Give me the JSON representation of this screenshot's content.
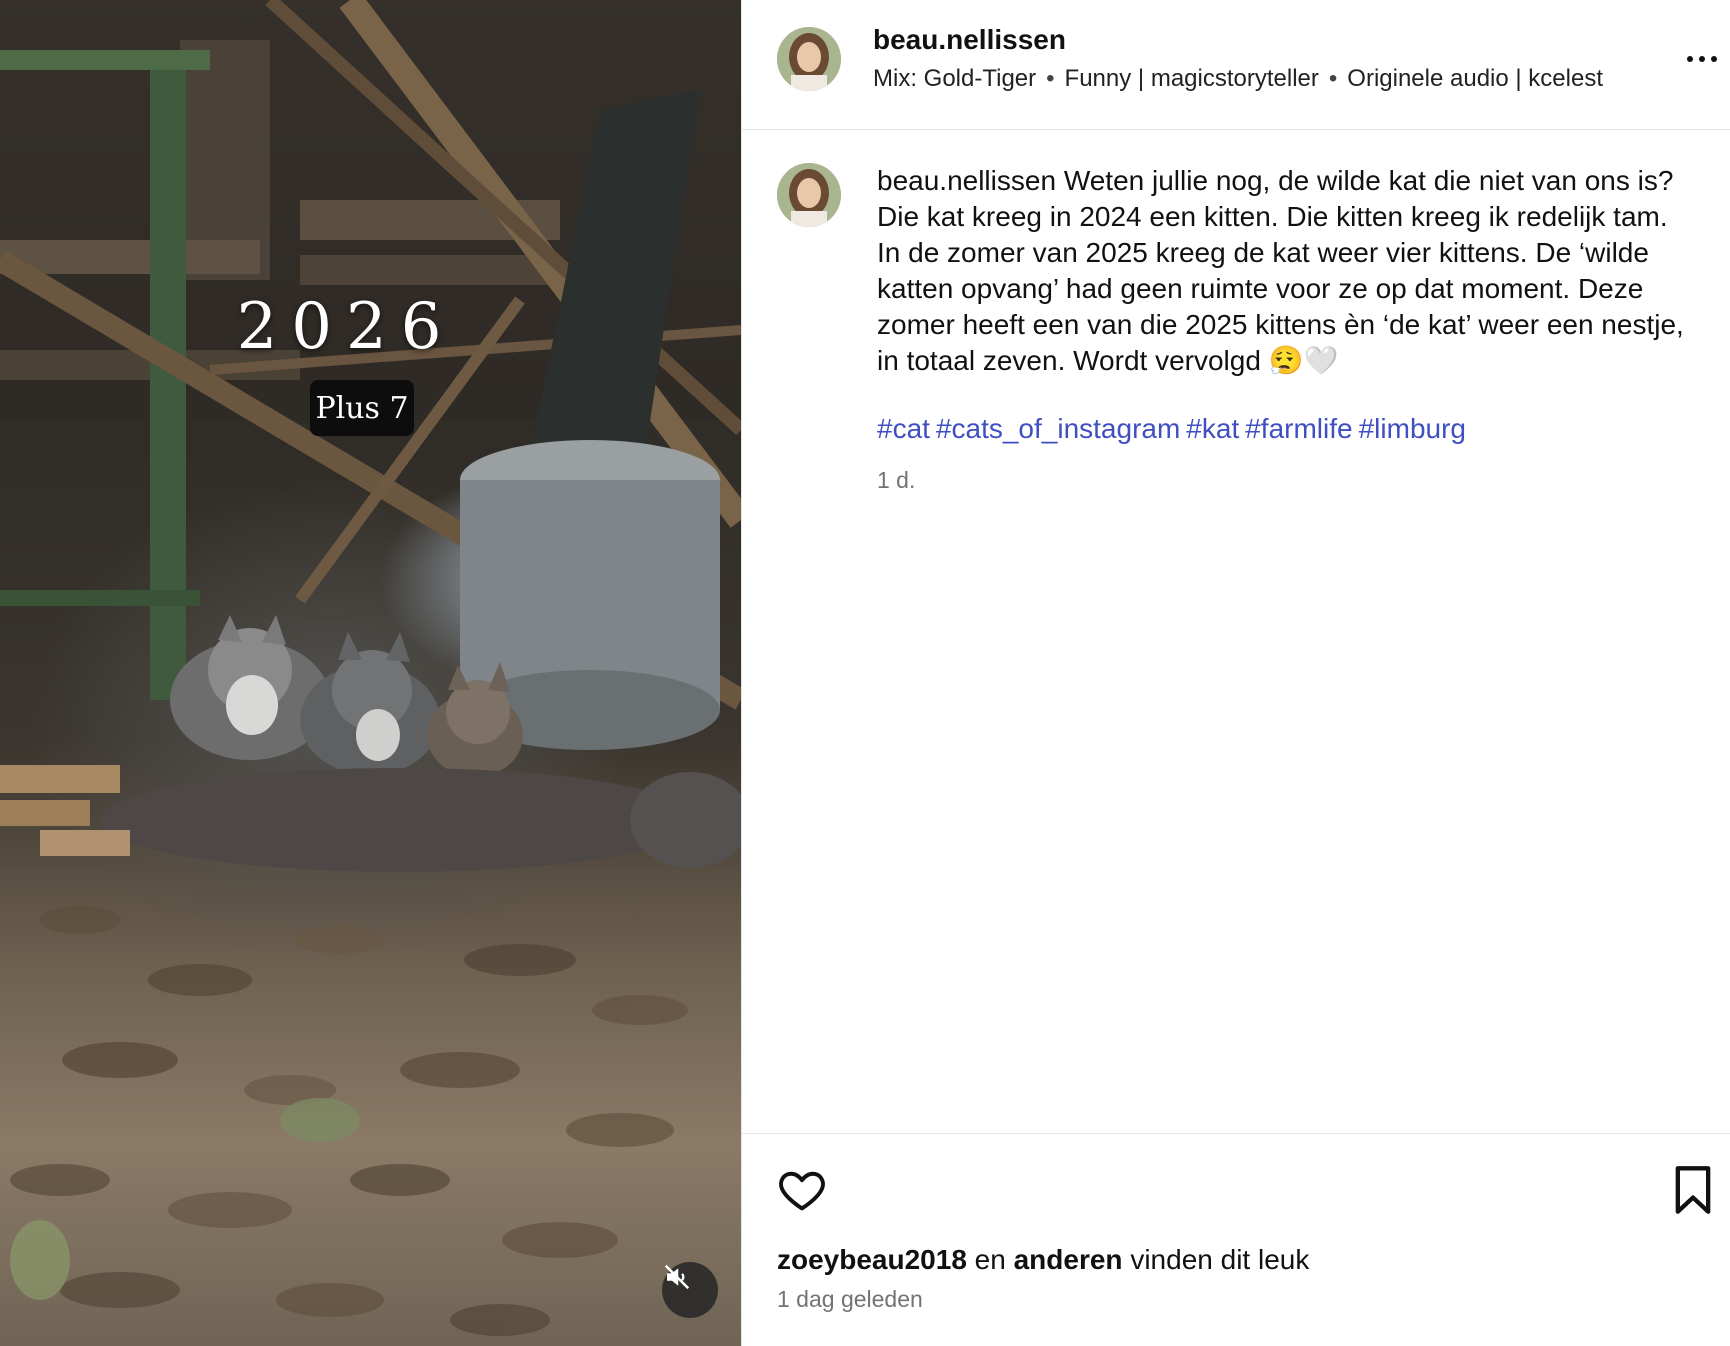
{
  "media": {
    "overlay_year": "2026",
    "overlay_subtitle": "Plus 7",
    "mute_icon": "speaker-muted-icon"
  },
  "post": {
    "author": "beau.nellissen",
    "audio": {
      "mix_label": "Mix: Gold-Tiger",
      "track_1": "Funny | magicstoryteller",
      "track_2": "Originele audio | kcelest",
      "separator": "•"
    },
    "caption_user": "beau.nellissen",
    "caption_text": "Weten jullie nog, de wilde kat die niet van ons is? Die kat kreeg in 2024 een kitten. Die kitten kreeg ik redelijk tam. In de zomer van 2025 kreeg de kat weer vier kittens. De ‘wilde katten opvang’ had geen ruimte voor ze op dat moment. Deze zomer heeft een van die 2025 kittens èn ‘de kat’ weer een nestje, in totaal zeven. Wordt vervolgd 😮‍💨🤍",
    "hashtags": [
      "#cat",
      "#cats_of_instagram",
      "#kat",
      "#farmlife",
      "#limburg"
    ],
    "timestamp": "1 d."
  },
  "footer": {
    "liked_by_user": "zoeybeau2018",
    "liked_by_connector": "en",
    "liked_by_others": "anderen",
    "liked_by_suffix": "vinden dit leuk",
    "posted_ago": "1 dag geleden"
  },
  "icons": {
    "like": "heart-icon",
    "save": "bookmark-icon",
    "more": "more-options-icon"
  },
  "colors": {
    "hashtag": "#3f4fc2",
    "muted_text": "#737373",
    "divider": "#e6e6e6"
  }
}
